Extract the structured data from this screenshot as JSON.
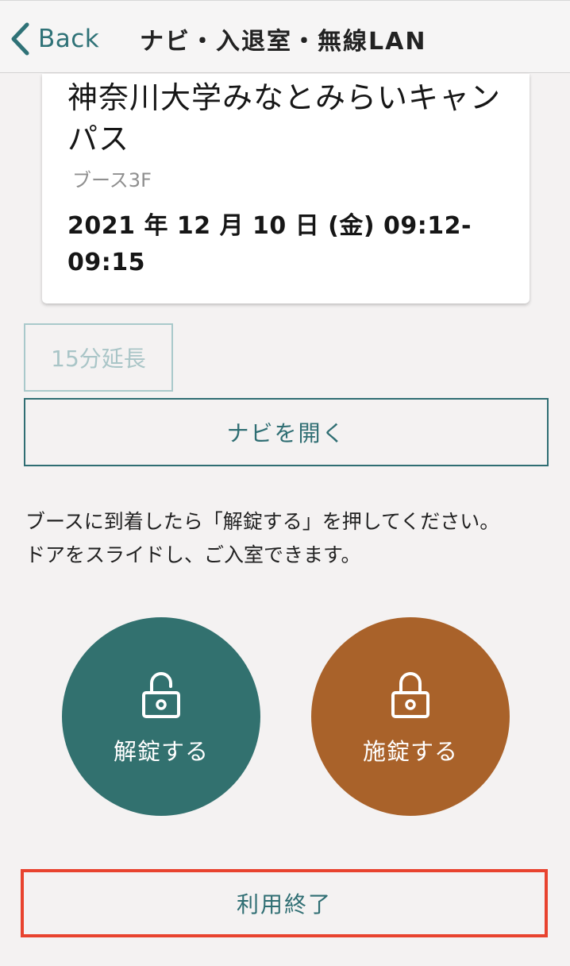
{
  "header": {
    "back_label": "Back",
    "title": "ナビ・入退室・無線LAN"
  },
  "reservation": {
    "venue": "神奈川大学みなとみらいキャンパス",
    "booth": "ブース3F",
    "datetime": "2021 年 12 月 10 日 (金) 09:12-09:15"
  },
  "buttons": {
    "extend_label": "15分延長",
    "open_navi_label": "ナビを開く",
    "unlock_label": "解錠する",
    "lock_label": "施錠する",
    "end_use_label": "利用終了"
  },
  "instructions": {
    "line1": "ブースに到着したら「解錠する」を押してください。",
    "line2": "ドアをスライドし、ご入室できます。"
  },
  "icons": {
    "back": "chevron-left-icon",
    "unlock": "unlock-icon",
    "lock": "lock-icon"
  },
  "colors": {
    "accent": "#2f6e73",
    "unlock_bg": "#32716f",
    "lock_bg": "#a9622a",
    "highlight_border": "#e8432f",
    "disabled": "#a9c9cb"
  }
}
